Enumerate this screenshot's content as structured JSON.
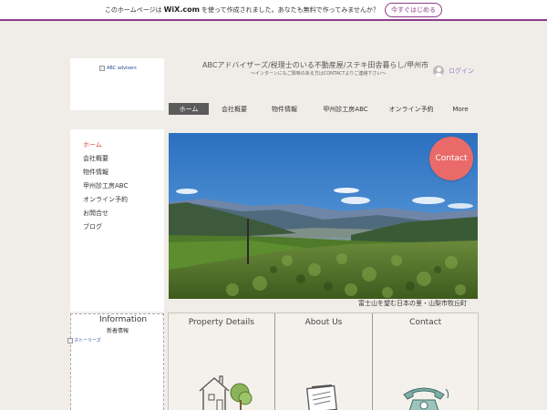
{
  "banner": {
    "text_before": "このホームページは",
    "wix": "WiX.com",
    "text_after": "を使って作成されました。あなたも無料で作ってみませんか？",
    "button": "今すぐはじめる"
  },
  "logo": {
    "alt": "ABC advisers"
  },
  "header": {
    "title": "ABCアドバイザーズ/税理士のいる不動産屋/ステキ田舎暮らし/甲州市",
    "subtitle": "～インターンにもご興味のある方はCONTACTよりご連絡下さい～"
  },
  "login": {
    "label": "ログイン"
  },
  "topnav": {
    "items": [
      {
        "label": "ホーム"
      },
      {
        "label": "会社概要"
      },
      {
        "label": "物件情報"
      },
      {
        "label": "甲州診工房ABC"
      },
      {
        "label": "オンライン予約"
      },
      {
        "label": "More"
      }
    ]
  },
  "sidebar": {
    "items": [
      {
        "label": "ホーム"
      },
      {
        "label": "会社概要"
      },
      {
        "label": "物件情報"
      },
      {
        "label": "甲州診工房ABC"
      },
      {
        "label": "オンライン予約"
      },
      {
        "label": "お問合せ"
      },
      {
        "label": "ブログ"
      }
    ]
  },
  "info": {
    "title": "Information",
    "subtitle": "新着情報",
    "image_alt": "ストーリーズ"
  },
  "hero": {
    "contact_button": "Contact",
    "caption": "富士山を望む日本の里・山梨市牧丘町"
  },
  "columns": [
    {
      "title": "Property Details"
    },
    {
      "title": "About Us"
    },
    {
      "title": "Contact"
    }
  ],
  "colors": {
    "accent_purple": "#8d3a8a",
    "contact_red": "#e96a68",
    "nav_active_bg": "#5b5b5b",
    "sidebar_active": "#d64a3e",
    "login_text": "#9a76c2"
  }
}
